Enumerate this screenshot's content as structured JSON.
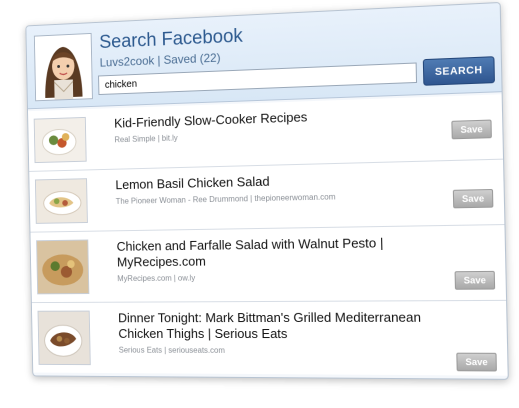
{
  "header": {
    "title": "Search Facebook",
    "subtitle": "Luvs2cook | Saved (22)",
    "search_value": "chicken",
    "search_button": "SEARCH"
  },
  "results": [
    {
      "title": "Kid-Friendly Slow-Cooker Recipes",
      "meta": "Real Simple | bit.ly",
      "save": "Save"
    },
    {
      "title": "Lemon Basil Chicken Salad",
      "meta": "The Pioneer Woman - Ree Drummond | thepioneerwoman.com",
      "save": "Save"
    },
    {
      "title": "Chicken and Farfalle Salad with Walnut Pesto | MyRecipes.com",
      "meta": "MyRecipes.com | ow.ly",
      "save": "Save"
    },
    {
      "title": "Dinner Tonight: Mark Bittman's Grilled Mediterranean Chicken Thighs | Serious Eats",
      "meta": "Serious Eats | seriouseats.com",
      "save": "Save"
    }
  ]
}
